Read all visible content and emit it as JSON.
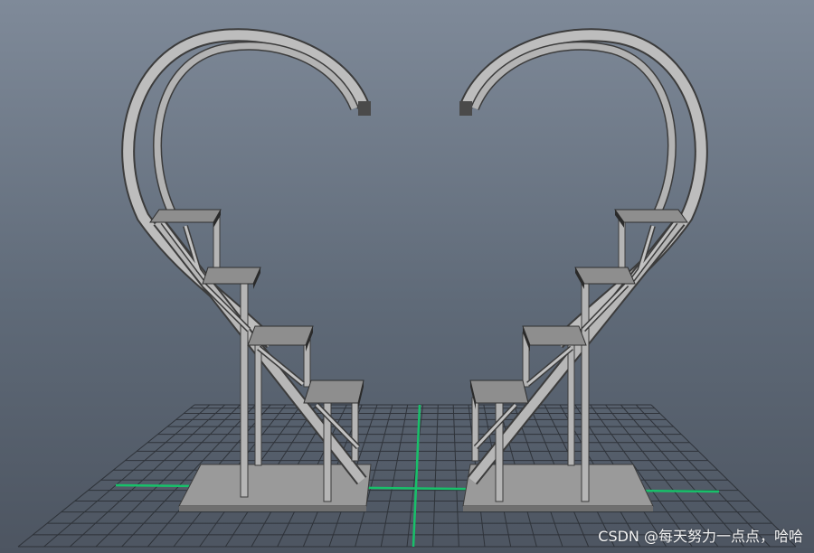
{
  "viewport": {
    "background_top": "#7f8a99",
    "background_bottom": "#4d5561",
    "grid_color": "#2b2f35",
    "axis_color": "#18c06a",
    "model_color": "#b7b7b7",
    "model_dark": "#6f6f6f",
    "model_edge": "#3c3c3c"
  },
  "watermark": {
    "text": "CSDN @每天努力一点点，哈哈"
  }
}
